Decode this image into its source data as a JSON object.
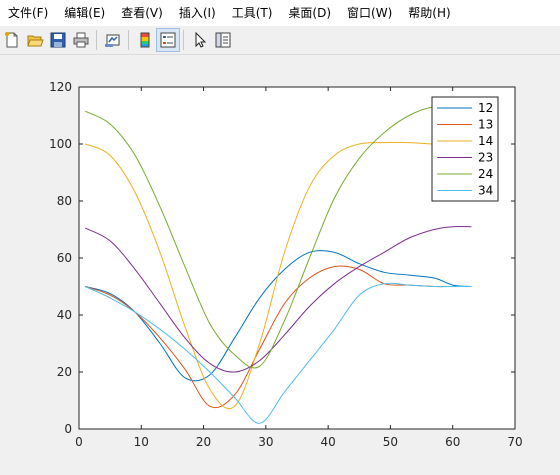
{
  "menu": [
    {
      "label": "文件(F)"
    },
    {
      "label": "编辑(E)"
    },
    {
      "label": "查看(V)"
    },
    {
      "label": "插入(I)"
    },
    {
      "label": "工具(T)"
    },
    {
      "label": "桌面(D)"
    },
    {
      "label": "窗口(W)"
    },
    {
      "label": "帮助(H)"
    }
  ],
  "toolbar": {
    "buttons": [
      "new-file",
      "open-file",
      "save",
      "print",
      "link-plot",
      "insert-colorbar",
      "insert-legend",
      "edit-plot",
      "property-inspector"
    ]
  },
  "chart_data": {
    "type": "line",
    "title": "",
    "xlabel": "",
    "ylabel": "",
    "xlim": [
      0,
      70
    ],
    "ylim": [
      0,
      120
    ],
    "xticks": [
      0,
      10,
      20,
      30,
      40,
      50,
      60,
      70
    ],
    "yticks": [
      0,
      20,
      40,
      60,
      80,
      100,
      120
    ],
    "legend_position": "top-right",
    "x": [
      1,
      5,
      9,
      13,
      17,
      21,
      25,
      29,
      33,
      37,
      41,
      45,
      49,
      53,
      57,
      60,
      63
    ],
    "series": [
      {
        "name": "12",
        "color": "#0072BD",
        "values": [
          50,
          47.5,
          41,
          30,
          18,
          19,
          32,
          46,
          56,
          62,
          62,
          58,
          55,
          54,
          53,
          50.5,
          50
        ]
      },
      {
        "name": "13",
        "color": "#D95319",
        "values": [
          50,
          47,
          41,
          32,
          21,
          8,
          12,
          28,
          44,
          53,
          57,
          56,
          51,
          50.5,
          50,
          50,
          50
        ]
      },
      {
        "name": "14",
        "color": "#EDB120",
        "values": [
          100,
          96,
          83,
          62,
          36,
          14,
          8,
          30,
          62,
          85,
          96,
          100,
          100.5,
          100.5,
          100,
          100,
          100
        ]
      },
      {
        "name": "23",
        "color": "#7E2F8E",
        "values": [
          70.5,
          66,
          56,
          44,
          32,
          23,
          20,
          24,
          33,
          43,
          51,
          57,
          62,
          67,
          70,
          71,
          71
        ]
      },
      {
        "name": "24",
        "color": "#77AC30",
        "values": [
          111.5,
          107,
          96,
          78,
          57,
          37,
          26,
          22,
          38,
          60,
          81,
          95,
          104,
          110,
          113,
          112,
          111
        ]
      },
      {
        "name": "34",
        "color": "#4DBEEE",
        "values": [
          50,
          46,
          41,
          35,
          28,
          20,
          11,
          2,
          13,
          24,
          35,
          47,
          51,
          50.5,
          50,
          50,
          50
        ]
      }
    ]
  }
}
